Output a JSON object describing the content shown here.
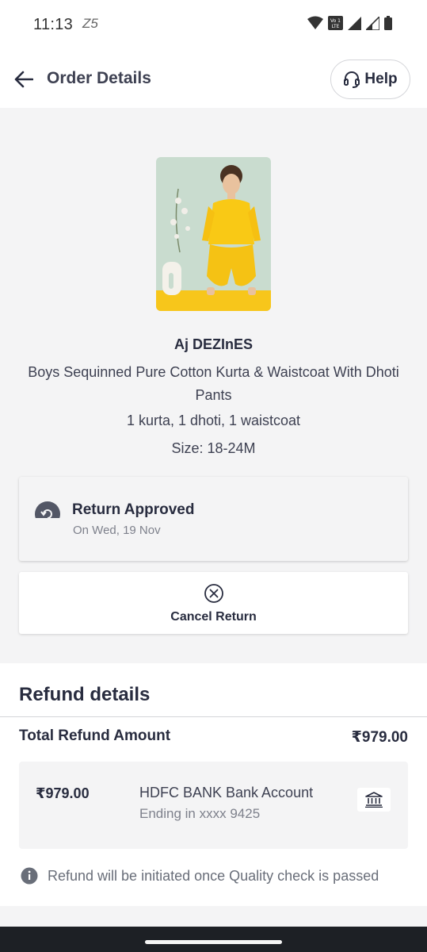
{
  "status_bar": {
    "time": "11:13",
    "notification": "Z5"
  },
  "header": {
    "title": "Order Details",
    "help_label": "Help"
  },
  "product": {
    "brand": "Aj DEZInES",
    "name": "Boys Sequinned Pure Cotton Kurta & Waistcoat With Dhoti Pants",
    "contents": "1 kurta, 1 dhoti, 1 waistcoat",
    "size": "Size: 18-24M"
  },
  "order_status": {
    "title": "Return Approved",
    "date": "On Wed, 19 Nov"
  },
  "cancel_return": {
    "label": "Cancel Return"
  },
  "refund": {
    "section_title": "Refund details",
    "total_label": "Total Refund Amount",
    "total_amount": "₹979.00",
    "method_amount": "₹979.00",
    "bank_name": "HDFC BANK Bank Account",
    "bank_ending": "Ending in xxxx 9425",
    "info_text": "Refund will be initiated once Quality check is passed"
  },
  "colors": {
    "text_primary": "#282c3f",
    "text_secondary": "#7e818c",
    "page_grey": "#f4f4f5",
    "product_yellow": "#f7c61b"
  }
}
